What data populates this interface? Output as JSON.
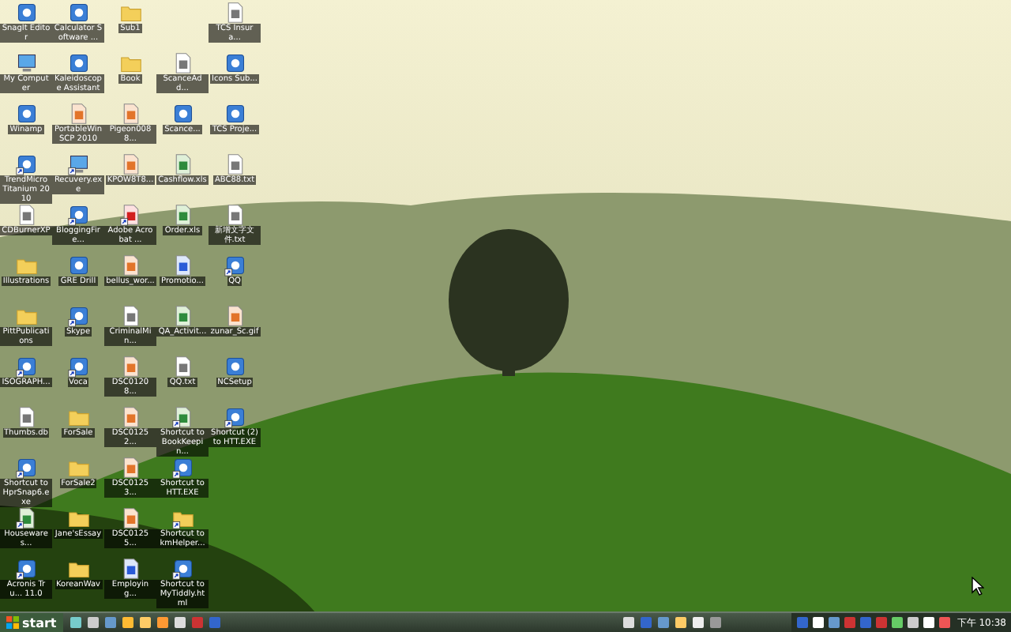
{
  "desktop": {
    "columns": [
      {
        "icons": [
          {
            "label": "SnagIt Editor",
            "kind": "app",
            "shortcut": false
          },
          {
            "label": "My Computer",
            "kind": "computer",
            "shortcut": false
          },
          {
            "label": "Winamp",
            "kind": "app",
            "shortcut": false
          },
          {
            "label": "TrendMicro Titanium 2010",
            "kind": "app",
            "shortcut": true
          },
          {
            "label": "CDBurnerXP",
            "kind": "document",
            "shortcut": false
          },
          {
            "label": "Illustrations",
            "kind": "folder",
            "shortcut": false
          },
          {
            "label": "PittPublications",
            "kind": "folder",
            "shortcut": false
          },
          {
            "label": "ISOGRAPH...",
            "kind": "app",
            "shortcut": true
          },
          {
            "label": "Thumbs.db",
            "kind": "document",
            "shortcut": false
          },
          {
            "label": "Shortcut to HprSnap6.exe",
            "kind": "app",
            "shortcut": true
          },
          {
            "label": "Housewares...",
            "kind": "spreadsheet",
            "shortcut": true
          },
          {
            "label": "Acronis Tru... 11.0",
            "kind": "app",
            "shortcut": true
          }
        ]
      },
      {
        "icons": [
          {
            "label": "Calculator Software ...",
            "kind": "app",
            "shortcut": false
          },
          {
            "label": "Kaleidoscope Assistant",
            "kind": "app",
            "shortcut": false
          },
          {
            "label": "PortableWinSCP 2010",
            "kind": "image",
            "shortcut": false
          },
          {
            "label": "Recuvery.exe",
            "kind": "computer",
            "shortcut": true
          },
          {
            "label": "BloggingFire...",
            "kind": "app",
            "shortcut": true
          },
          {
            "label": "GRE Drill",
            "kind": "app",
            "shortcut": false
          },
          {
            "label": "Skype",
            "kind": "app",
            "shortcut": true
          },
          {
            "label": "Voca",
            "kind": "app",
            "shortcut": true
          },
          {
            "label": "ForSale",
            "kind": "folder",
            "shortcut": false
          },
          {
            "label": "ForSale2",
            "kind": "folder",
            "shortcut": false
          },
          {
            "label": "Jane'sEssay",
            "kind": "folder",
            "shortcut": false
          },
          {
            "label": "KoreanWav",
            "kind": "folder",
            "shortcut": false
          }
        ]
      },
      {
        "icons": [
          {
            "label": "Sub1",
            "kind": "folder",
            "shortcut": false
          },
          {
            "label": "Book",
            "kind": "folder",
            "shortcut": false
          },
          {
            "label": "Pigeon0088...",
            "kind": "image",
            "shortcut": false
          },
          {
            "label": "KPOW8T8...",
            "kind": "image",
            "shortcut": false
          },
          {
            "label": "Adobe Acrobat ...",
            "kind": "pdf",
            "shortcut": true
          },
          {
            "label": "bellus_wor...",
            "kind": "image",
            "shortcut": false
          },
          {
            "label": "CriminalMin...",
            "kind": "document",
            "shortcut": false
          },
          {
            "label": "DSC01208...",
            "kind": "image",
            "shortcut": false
          },
          {
            "label": "DSC01252...",
            "kind": "image",
            "shortcut": false
          },
          {
            "label": "DSC01253...",
            "kind": "image",
            "shortcut": false
          },
          {
            "label": "DSC01255...",
            "kind": "image",
            "shortcut": false
          },
          {
            "label": "Employing...",
            "kind": "word",
            "shortcut": false
          }
        ]
      },
      {
        "icons": [
          {
            "label": "ScanceAdd...",
            "kind": "document",
            "shortcut": false
          },
          {
            "label": "Scance...",
            "kind": "app",
            "shortcut": false
          },
          {
            "label": "Cashflow.xls",
            "kind": "spreadsheet",
            "shortcut": false
          },
          {
            "label": "Order.xls",
            "kind": "spreadsheet",
            "shortcut": false
          },
          {
            "label": "Promotio...",
            "kind": "word",
            "shortcut": false
          },
          {
            "label": "QA_Activit...",
            "kind": "spreadsheet",
            "shortcut": false
          },
          {
            "label": "QQ.txt",
            "kind": "document",
            "shortcut": false
          },
          {
            "label": "Shortcut to BookKeepin...",
            "kind": "spreadsheet",
            "shortcut": true
          },
          {
            "label": "Shortcut to HTT.EXE",
            "kind": "app",
            "shortcut": true
          },
          {
            "label": "Shortcut to kmHelper...",
            "kind": "folder",
            "shortcut": true
          },
          {
            "label": "Shortcut to MyTiddly.html",
            "kind": "app",
            "shortcut": true
          }
        ]
      },
      {
        "icons": [
          {
            "label": "TCS Insura...",
            "kind": "document",
            "shortcut": false
          },
          {
            "label": "Icons Sub...",
            "kind": "app",
            "shortcut": false
          },
          {
            "label": "TCS Proje...",
            "kind": "app",
            "shortcut": false
          },
          {
            "label": "ABC88.txt",
            "kind": "document",
            "shortcut": false
          },
          {
            "label": "新增文字文件.txt",
            "kind": "document",
            "shortcut": false
          },
          {
            "label": "QQ",
            "kind": "app",
            "shortcut": true
          },
          {
            "label": "zunar_Sc.gif",
            "kind": "image",
            "shortcut": false
          },
          {
            "label": "NCSetup",
            "kind": "app",
            "shortcut": false
          },
          {
            "label": "Shortcut (2) to HTT.EXE",
            "kind": "app",
            "shortcut": true
          }
        ]
      }
    ]
  },
  "taskbar": {
    "start": "start",
    "clock": "下午 10:38"
  }
}
